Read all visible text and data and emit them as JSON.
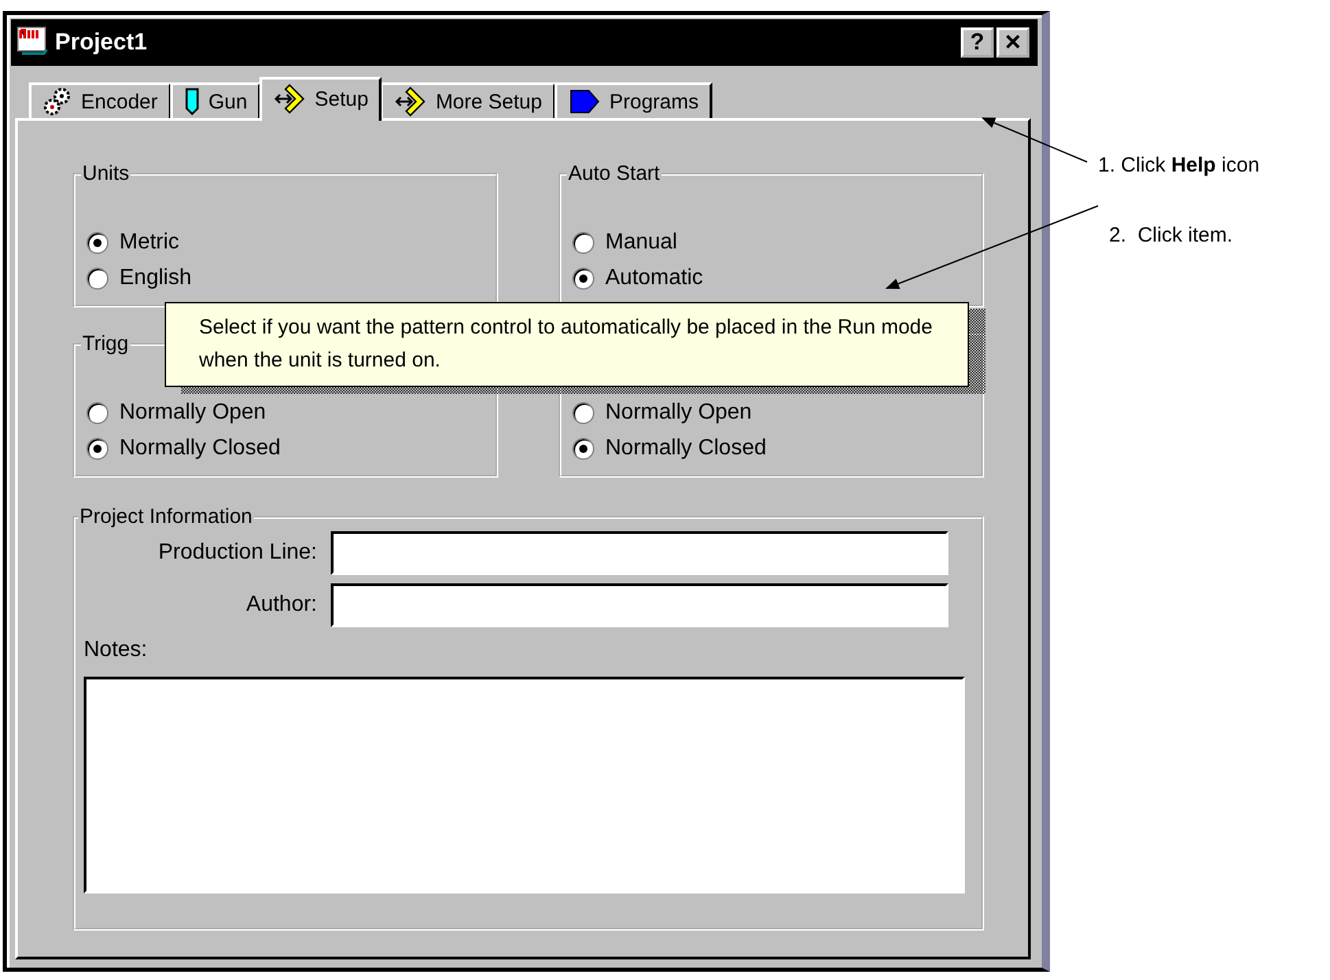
{
  "window": {
    "title": "Project1"
  },
  "title_buttons": [
    {
      "kind": "help",
      "label": "?"
    },
    {
      "kind": "close",
      "label": "×"
    }
  ],
  "tabs": [
    {
      "label": "Encoder",
      "kind": "gears",
      "selected": false
    },
    {
      "label": "Gun",
      "kind": "marker",
      "selected": false
    },
    {
      "label": "Setup",
      "kind": "arrow",
      "selected": true
    },
    {
      "label": "More Setup",
      "kind": "arrow",
      "selected": false
    },
    {
      "label": "Programs",
      "kind": "pointer",
      "selected": false
    }
  ],
  "groups": [
    {
      "label": "Units",
      "options": [
        {
          "label": "Metric",
          "selected": true
        },
        {
          "label": "English",
          "selected": false
        }
      ]
    },
    {
      "label": "Auto Start",
      "options": [
        {
          "label": "Manual",
          "selected": false
        },
        {
          "label": "Automatic",
          "selected": true
        }
      ]
    },
    {
      "label": "Trigg",
      "options": [
        {
          "label": "Normally Open",
          "selected": false
        },
        {
          "label": "Normally Closed",
          "selected": true
        }
      ]
    },
    {
      "options": [
        {
          "label": "Normally Open",
          "selected": false
        },
        {
          "label": "Normally Closed",
          "selected": true
        }
      ]
    }
  ],
  "project_information": {
    "label": "Project Information",
    "fields": [
      {
        "label": "Production Line:"
      },
      {
        "label": "Author:"
      }
    ],
    "notes": {
      "label": "Notes:"
    }
  },
  "tooltip": {
    "text": "Select if you want the pattern control to automatically be placed in the Run mode when the unit is turned on."
  },
  "annotations": [
    {
      "text": "1. Click **Help** icon"
    },
    {
      "text": "2.  Click item."
    }
  ]
}
